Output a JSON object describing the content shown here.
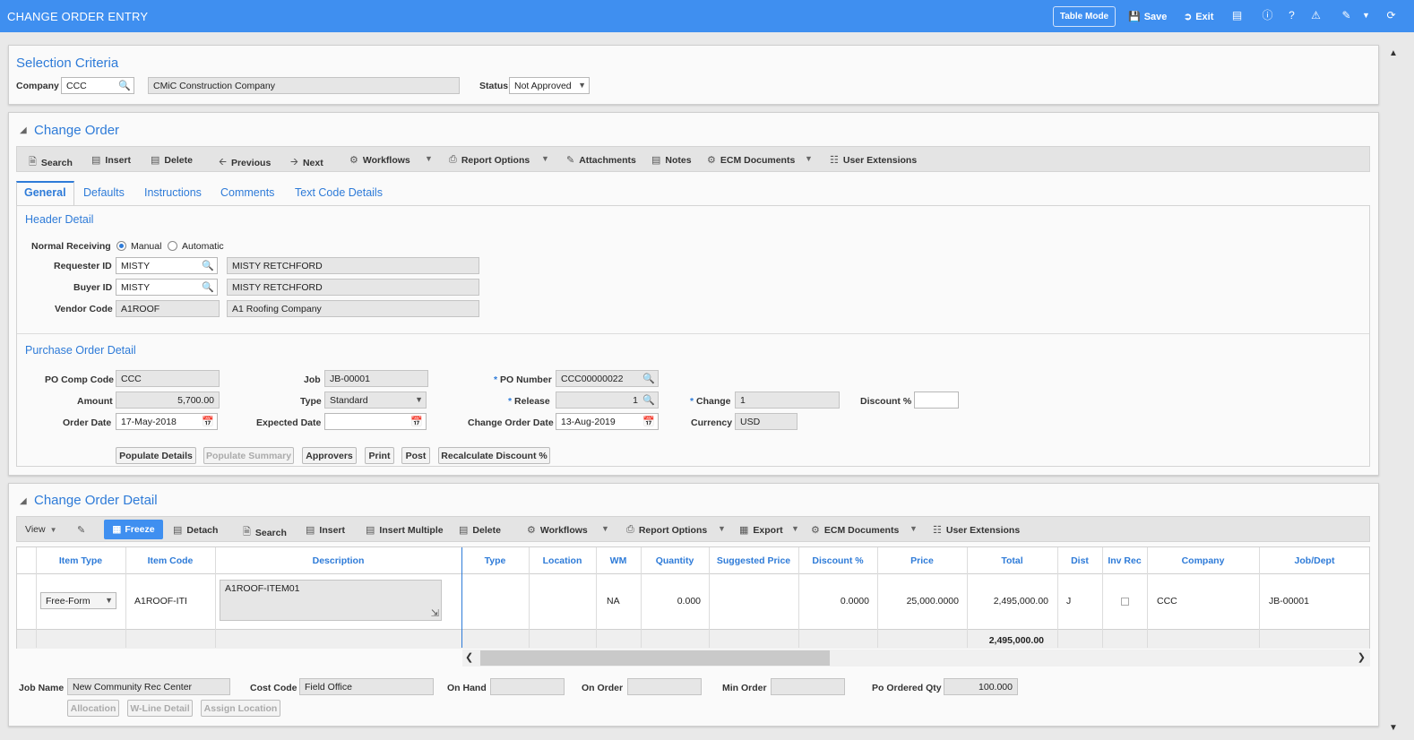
{
  "app": {
    "title": "CHANGE ORDER ENTRY"
  },
  "topbar": {
    "table_mode": "Table Mode",
    "save": "Save",
    "exit": "Exit"
  },
  "selection": {
    "title": "Selection Criteria",
    "company_label": "Company",
    "company_value": "CCC",
    "company_name": "CMiC Construction Company",
    "status_label": "Status",
    "status_value": "Not Approved"
  },
  "change_order": {
    "title": "Change Order",
    "toolbar": [
      "Search",
      "Insert",
      "Delete",
      "Previous",
      "Next",
      "Workflows",
      "Report Options",
      "Attachments",
      "Notes",
      "ECM Documents",
      "User Extensions"
    ],
    "tabs": [
      "General",
      "Defaults",
      "Instructions",
      "Comments",
      "Text Code Details"
    ],
    "header_detail": {
      "title": "Header Detail",
      "normal_receiving_label": "Normal Receiving",
      "manual": "Manual",
      "automatic": "Automatic",
      "requester_label": "Requester ID",
      "requester_value": "MISTY",
      "requester_name": "MISTY RETCHFORD",
      "buyer_label": "Buyer ID",
      "buyer_value": "MISTY",
      "buyer_name": "MISTY RETCHFORD",
      "vendor_label": "Vendor Code",
      "vendor_value": "A1ROOF",
      "vendor_name": "A1 Roofing Company"
    },
    "po_detail": {
      "title": "Purchase Order Detail",
      "po_comp_label": "PO Comp Code",
      "po_comp_value": "CCC",
      "amount_label": "Amount",
      "amount_value": "5,700.00",
      "order_date_label": "Order Date",
      "order_date_value": "17-May-2018",
      "job_label": "Job",
      "job_value": "JB-00001",
      "type_label": "Type",
      "type_value": "Standard",
      "expected_label": "Expected Date",
      "expected_value": "",
      "po_number_label": "PO Number",
      "po_number_value": "CCC00000022",
      "release_label": "Release",
      "release_value": "1",
      "cod_label": "Change Order Date",
      "cod_value": "13-Aug-2019",
      "change_label": "Change",
      "change_value": "1",
      "currency_label": "Currency",
      "currency_value": "USD",
      "discount_label": "Discount %",
      "discount_value": ""
    },
    "buttons": [
      "Populate Details",
      "Populate Summary",
      "Approvers",
      "Print",
      "Post",
      "Recalculate Discount %"
    ]
  },
  "detail": {
    "title": "Change Order Detail",
    "toolbar": [
      "View",
      "Freeze",
      "Detach",
      "Search",
      "Insert",
      "Insert Multiple",
      "Delete",
      "Workflows",
      "Report Options",
      "Export",
      "ECM Documents",
      "User Extensions"
    ],
    "columns": [
      "Item Type",
      "Item Code",
      "Description",
      "Type",
      "Location",
      "WM",
      "Quantity",
      "Suggested Price",
      "Discount %",
      "Price",
      "Total",
      "Dist",
      "Inv Rec",
      "Company",
      "Job/Dept"
    ],
    "row": {
      "item_type": "Free-Form",
      "item_code": "A1ROOF-ITE",
      "description": "A1ROOF-ITEM01",
      "type": "",
      "location": "",
      "wm": "NA",
      "quantity": "0.000",
      "suggested_price": "",
      "discount": "0.0000",
      "price": "25,000.0000",
      "total": "2,495,000.00",
      "dist": "J",
      "company": "CCC",
      "job_dept": "JB-00001"
    },
    "total_row": "2,495,000.00",
    "footer": {
      "job_name_label": "Job Name",
      "job_name_value": "New Community Rec Center",
      "cost_code_label": "Cost Code",
      "cost_code_value": "Field Office",
      "on_hand_label": "On Hand",
      "on_order_label": "On Order",
      "min_order_label": "Min Order",
      "po_ordered_label": "Po Ordered Qty",
      "po_ordered_value": "100.000",
      "buttons": [
        "Allocation",
        "W-Line Detail",
        "Assign Location"
      ]
    }
  }
}
